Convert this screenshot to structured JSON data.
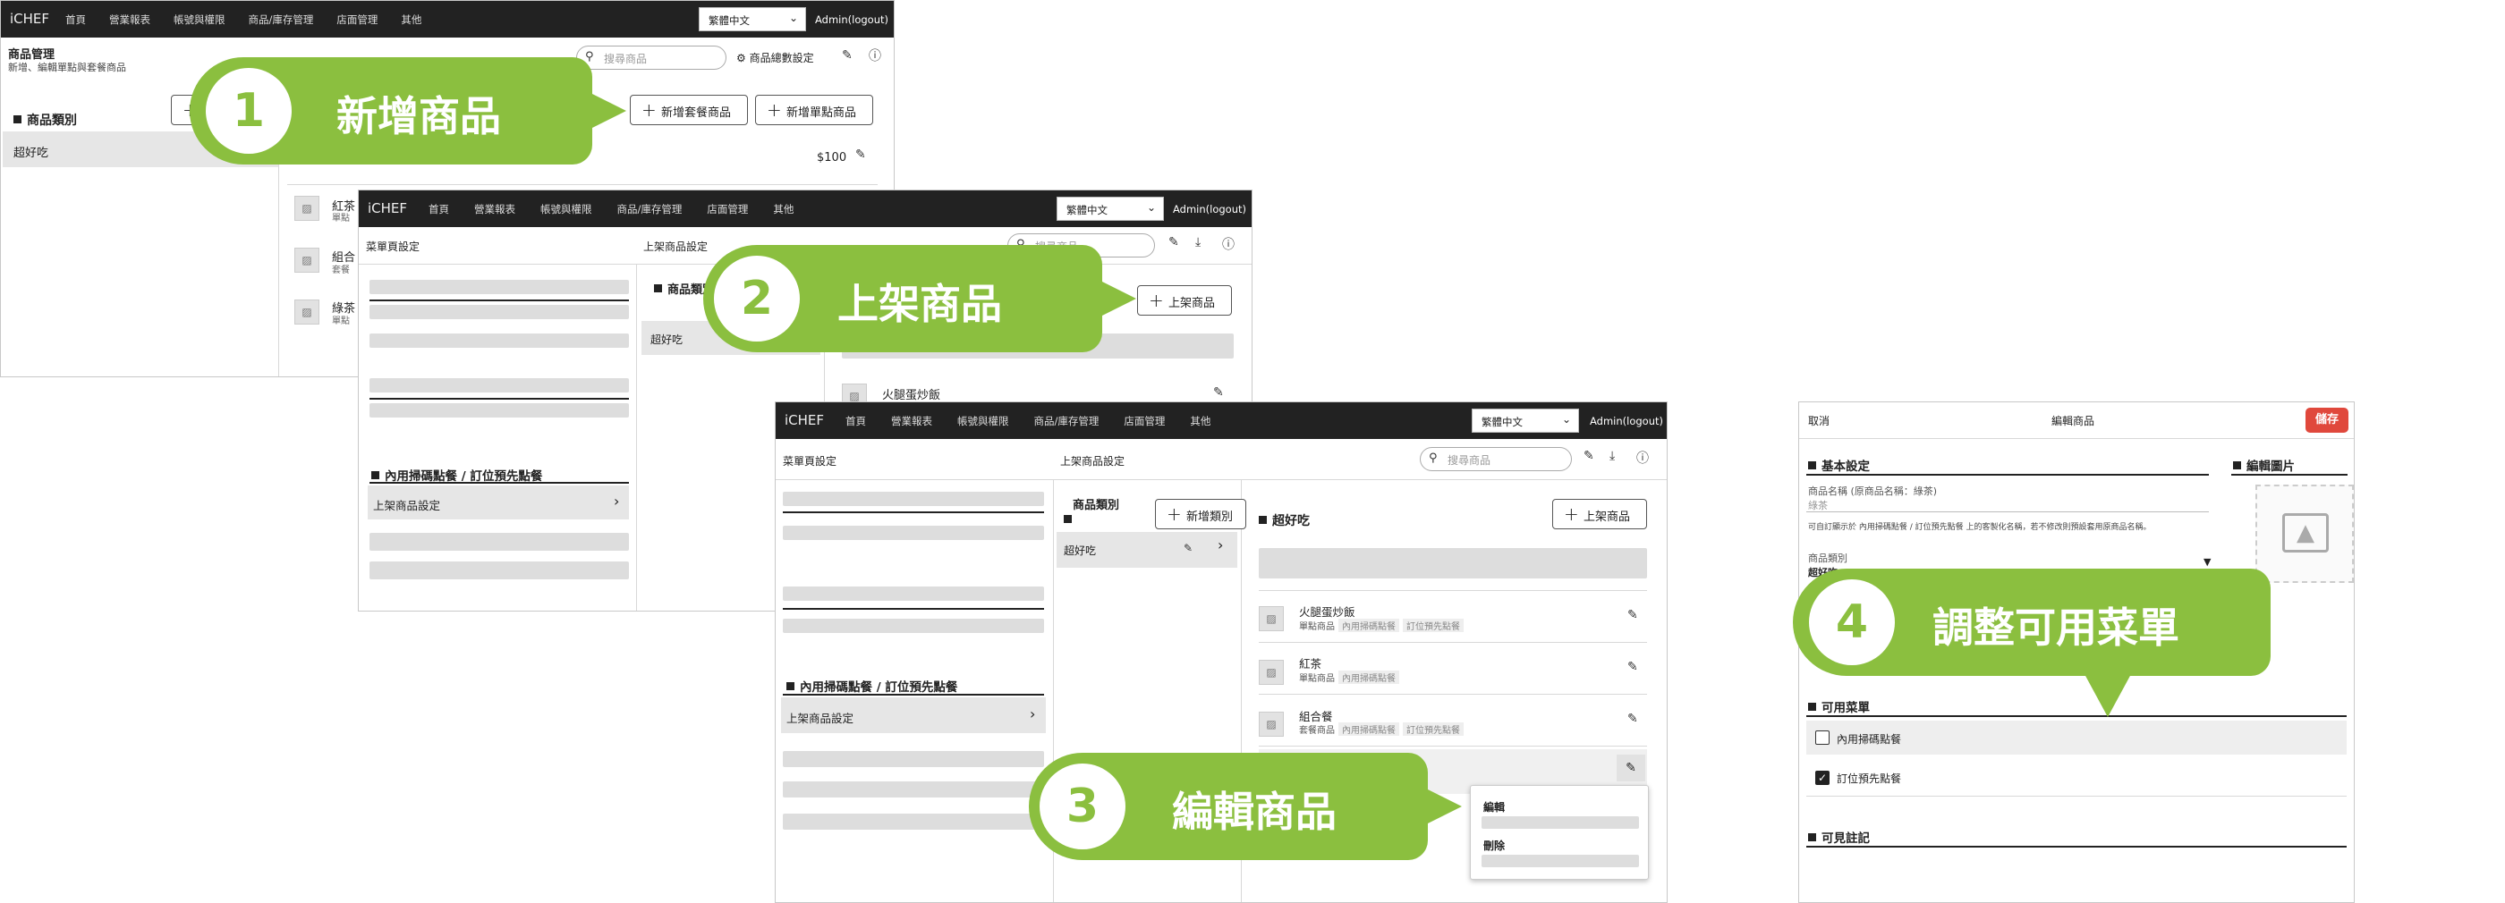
{
  "nav": {
    "logo": "iCHEF",
    "items": [
      "首頁",
      "營業報表",
      "帳號與權限",
      "商品/庫存管理",
      "店面管理",
      "其他"
    ],
    "language": "繁體中文",
    "admin": "Admin(logout)"
  },
  "w1": {
    "title": "商品管理",
    "subtitle": "新增、編輯單點與套餐商品",
    "search_placeholder": "搜尋商品",
    "settings_label": "商品總數設定",
    "section": "商品類別",
    "category": "超好吃",
    "add_combo": "新增套餐商品",
    "add_single": "新增單點商品",
    "price": "$100",
    "items": [
      {
        "name": "紅茶",
        "sub": "單點"
      },
      {
        "name": "組合",
        "sub": "套餐"
      },
      {
        "name": "綠茶",
        "sub": "單點"
      }
    ]
  },
  "w2": {
    "left_header": "菜單頁設定",
    "right_header": "上架商品設定",
    "search_placeholder": "搜尋商品",
    "section": "內用掃碼點餐 / 訂位預先點餐",
    "menu_setting": "上架商品設定",
    "cat_title": "商品類別",
    "category": "超好吃",
    "publish": "上架商品",
    "product": "火腿蛋炒飯"
  },
  "w3": {
    "left_header": "菜單頁設定",
    "right_header": "上架商品設定",
    "search_placeholder": "搜尋商品",
    "section": "內用掃碼點餐 / 訂位預先點餐",
    "menu_setting": "上架商品設定",
    "cat_title": "商品類別",
    "add_category": "新增類別",
    "category": "超好吃",
    "cat_heading": "超好吃",
    "publish": "上架商品",
    "products": [
      {
        "name": "火腿蛋炒飯",
        "type": "單點商品",
        "tags": [
          "內用掃碼點餐",
          "訂位預先點餐"
        ]
      },
      {
        "name": "紅茶",
        "type": "單點商品",
        "tags": [
          "內用掃碼點餐"
        ]
      },
      {
        "name": "組合餐",
        "type": "套餐商品",
        "tags": [
          "內用掃碼點餐",
          "訂位預先點餐"
        ]
      }
    ],
    "menu": {
      "edit": "編輯",
      "delete": "刪除"
    }
  },
  "w4": {
    "cancel": "取消",
    "title": "編輯商品",
    "save": "儲存",
    "basic": "基本設定",
    "image": "編輯圖片",
    "name_label": "商品名稱 (原商品名稱：綠茶)",
    "name_value": "綠茶",
    "hint": "可自訂顯示於 內用掃碼點餐 / 訂位預先點餐 上的客製化名稱，若不修改則預設套用原商品名稱。",
    "cat_label": "商品類別",
    "cat_value": "超好吃",
    "menus": "可用菜單",
    "opt1": "內用掃碼點餐",
    "opt2": "訂位預先點餐",
    "notes": "可見註記"
  },
  "callouts": [
    {
      "num": "1",
      "label": "新增商品"
    },
    {
      "num": "2",
      "label": "上架商品"
    },
    {
      "num": "3",
      "label": "編輯商品"
    },
    {
      "num": "4",
      "label": "調整可用菜單"
    }
  ],
  "colors": {
    "accent": "#8bbf3f",
    "save": "#e0483c",
    "nav": "#222222"
  }
}
